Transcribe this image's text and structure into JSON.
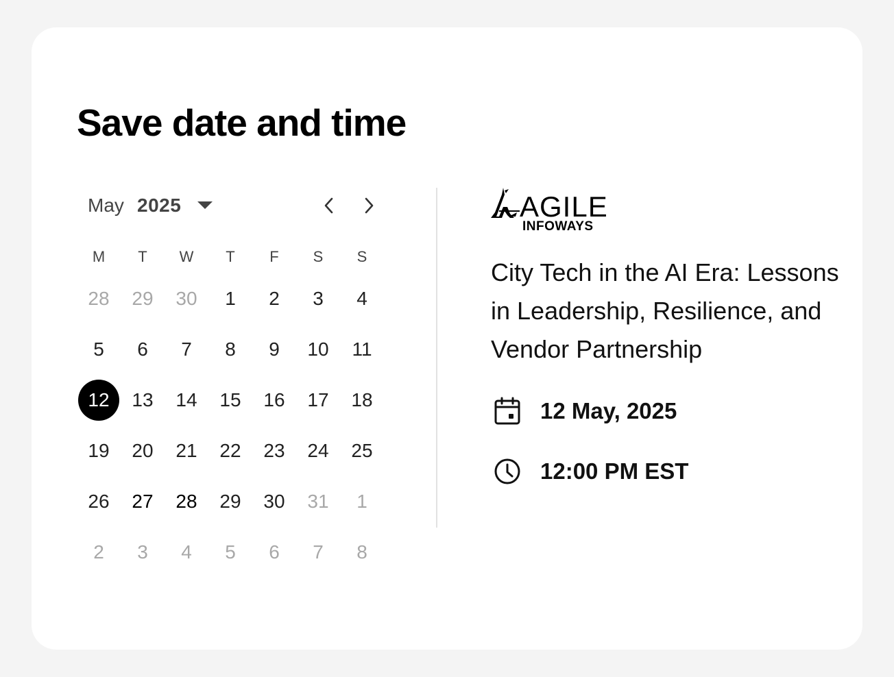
{
  "page": {
    "title": "Save date and time"
  },
  "calendar": {
    "month": "May",
    "year": "2025",
    "weekdays": [
      "M",
      "T",
      "W",
      "T",
      "F",
      "S",
      "S"
    ],
    "weeks": [
      [
        {
          "d": "28",
          "o": true
        },
        {
          "d": "29",
          "o": true
        },
        {
          "d": "30",
          "o": true
        },
        {
          "d": "1"
        },
        {
          "d": "2"
        },
        {
          "d": "3"
        },
        {
          "d": "4"
        }
      ],
      [
        {
          "d": "5"
        },
        {
          "d": "6"
        },
        {
          "d": "7"
        },
        {
          "d": "8"
        },
        {
          "d": "9"
        },
        {
          "d": "10"
        },
        {
          "d": "11"
        }
      ],
      [
        {
          "d": "12",
          "sel": true
        },
        {
          "d": "13"
        },
        {
          "d": "14"
        },
        {
          "d": "15"
        },
        {
          "d": "16"
        },
        {
          "d": "17"
        },
        {
          "d": "18"
        }
      ],
      [
        {
          "d": "19"
        },
        {
          "d": "20"
        },
        {
          "d": "21"
        },
        {
          "d": "22"
        },
        {
          "d": "23"
        },
        {
          "d": "24"
        },
        {
          "d": "25"
        }
      ],
      [
        {
          "d": "26"
        },
        {
          "d": "27",
          "b": true
        },
        {
          "d": "28",
          "b": true
        },
        {
          "d": "29"
        },
        {
          "d": "30"
        },
        {
          "d": "31",
          "o": true
        },
        {
          "d": "1",
          "o": true
        }
      ],
      [
        {
          "d": "2",
          "o": true
        },
        {
          "d": "3",
          "o": true
        },
        {
          "d": "4",
          "o": true
        },
        {
          "d": "5",
          "o": true
        },
        {
          "d": "6",
          "o": true
        },
        {
          "d": "7",
          "o": true
        },
        {
          "d": "8",
          "o": true
        }
      ]
    ],
    "icons": {
      "dropdown": "caret-down-icon",
      "prev": "chevron-left-icon",
      "next": "chevron-right-icon"
    }
  },
  "event": {
    "logo_main": "AGILE",
    "logo_sub": "INFOWAYS",
    "title": "City Tech in the AI Era: Lessons in Leadership, Resilience, and Vendor Partnership",
    "date": "12 May, 2025",
    "time": "12:00 PM EST",
    "icons": {
      "date": "calendar-icon",
      "time": "clock-icon"
    }
  },
  "colors": {
    "selected_bg": "#000000",
    "muted_day": "#a8a8a8",
    "page_bg": "#f4f4f4"
  }
}
